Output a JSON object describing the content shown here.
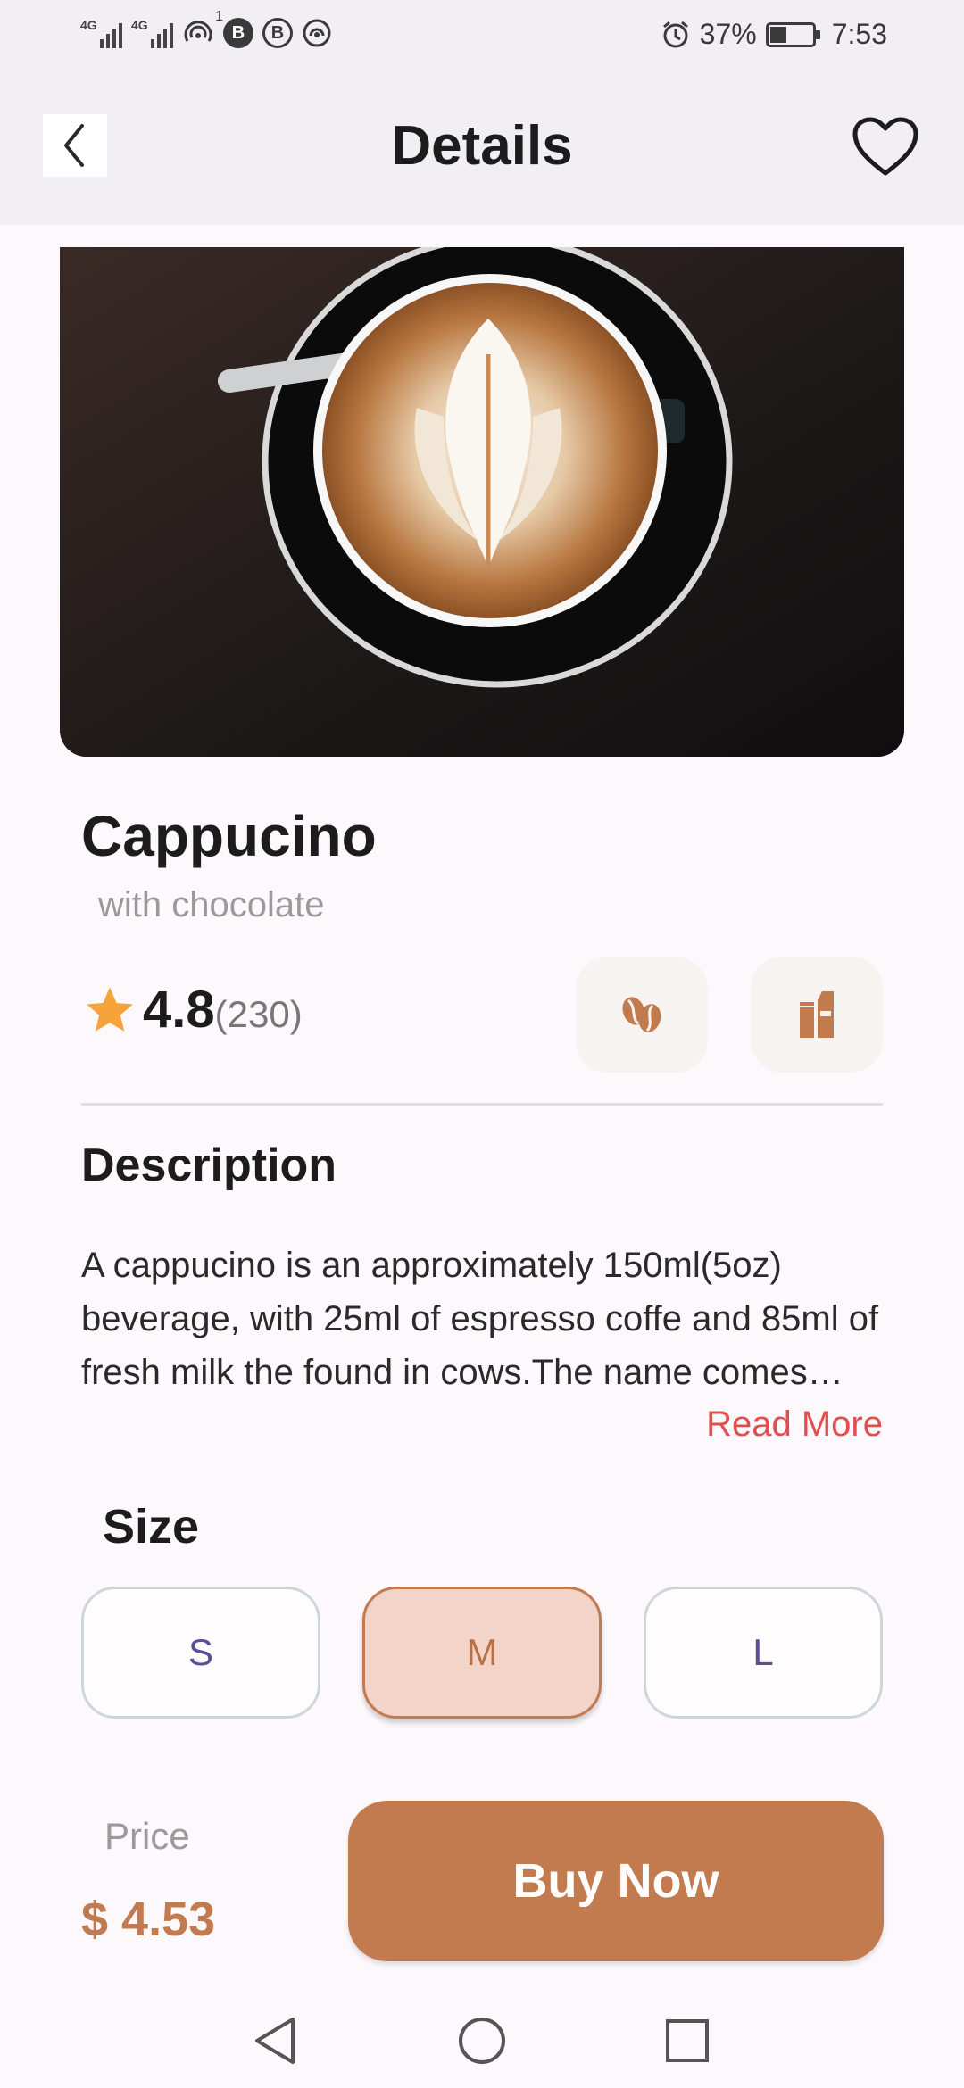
{
  "status_bar": {
    "network_1": "4G",
    "network_2": "4G",
    "sim_badge": "1",
    "app_badge_1": "B",
    "app_badge_2": "B",
    "battery": "37%",
    "time": "7:53"
  },
  "header": {
    "title": "Details",
    "back_icon": "chevron-left-icon",
    "favorite_icon": "heart-outline-icon"
  },
  "product": {
    "name": "Cappucino",
    "subtitle": "with chocolate",
    "rating": "4.8",
    "rating_count": "(230)",
    "feature_icons": [
      "coffee-beans-icon",
      "milk-carton-icon"
    ]
  },
  "description": {
    "heading": "Description",
    "text": "A cappucino is an approximately 150ml(5oz) beverage, with 25ml of espresso coffe and 85ml of fresh milk the found in cows.The name comes from",
    "read_more": "Read More"
  },
  "size": {
    "heading": "Size",
    "options": [
      "S",
      "M",
      "L"
    ],
    "selected": "M"
  },
  "footer": {
    "price_label": "Price",
    "price_value": "$ 4.53",
    "buy_label": "Buy Now"
  },
  "colors": {
    "accent": "#c27a4f",
    "selected_bg": "#f2d5c8",
    "read_more": "#e04e4e",
    "star": "#f6a33b"
  }
}
